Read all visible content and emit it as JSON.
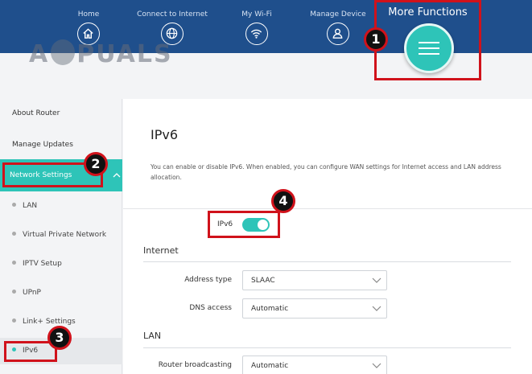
{
  "nav": {
    "items": [
      {
        "label": "Home",
        "icon": "home-icon"
      },
      {
        "label": "Connect to Internet",
        "icon": "globe-icon"
      },
      {
        "label": "My Wi-Fi",
        "icon": "wifi-icon"
      },
      {
        "label": "Manage Device",
        "icon": "user-icon"
      }
    ],
    "more_functions": "More Functions"
  },
  "watermark": "A PUALS",
  "badges": [
    "1",
    "2",
    "3",
    "4"
  ],
  "sidebar": {
    "about": "About Router",
    "updates": "Manage Updates",
    "network": "Network Settings",
    "sub": [
      "LAN",
      "Virtual Private Network",
      "IPTV Setup",
      "UPnP",
      "Link+ Settings",
      "IPv6"
    ]
  },
  "main": {
    "title": "IPv6",
    "description": "You can enable or disable IPv6. When enabled, you can configure WAN settings for Internet access and LAN address allocation.",
    "toggle_label": "IPv6",
    "toggle_on": true,
    "internet_heading": "Internet",
    "address_type_label": "Address type",
    "address_type_value": "SLAAC",
    "dns_label": "DNS access",
    "dns_value": "Automatic",
    "lan_heading": "LAN",
    "router_broadcast_label": "Router broadcasting",
    "router_broadcast_value": "Automatic"
  },
  "colors": {
    "header": "#1f4f8c",
    "accent": "#2ec4b8",
    "highlight": "#d0121b"
  }
}
